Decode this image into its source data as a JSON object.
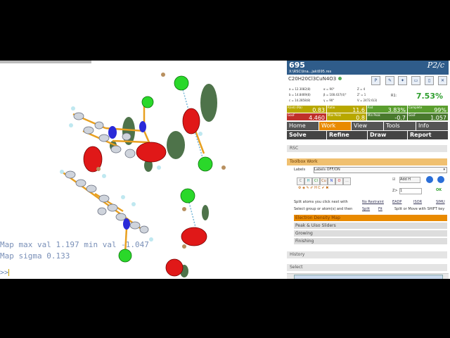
{
  "console": {
    "line1": "Map max val 1.197 min val -1.047",
    "line2": "Map sigma 0.133",
    "prompt": ">>"
  },
  "header": {
    "id": "695",
    "path": "X:\\RSC\\lina...jak\\695.res",
    "spacegroup": "P2/c",
    "formula": "C20H20Cl3CuN4O3"
  },
  "cell": {
    "a": "a = 12.3082(8)",
    "b": "b = 14.8469(8)",
    "c": "c = 14.2858(8)",
    "alpha": "α = 90°",
    "beta": "β = 108.437(4)°",
    "gamma": "γ = 90°",
    "z": "Z = 4",
    "zp": "Z' = 1",
    "v": "V = 2472.6(3)"
  },
  "r1": {
    "label": "R1:",
    "value": "7.53%"
  },
  "stats": [
    {
      "title": "R(int) (Rb)",
      "value": "0.83",
      "color": "#b8a800"
    },
    {
      "title": "Ratio",
      "value": "11.6",
      "color": "#b8a800"
    },
    {
      "title": "Rsd",
      "value": "3.83%",
      "color": "#5a9e2e"
    },
    {
      "title": "Complete",
      "value": "99%",
      "color": "#5a9e2e"
    },
    {
      "title": "GooF",
      "value": "4.460",
      "color": "#c0302a"
    },
    {
      "title": "Max Peak",
      "value": "0.8",
      "color": "#b8a800"
    },
    {
      "title": "Min Peak",
      "value": "-0.7",
      "color": "#4a7a2e"
    },
    {
      "title": "GooF",
      "value": "1.057",
      "color": "#4a7a2e"
    }
  ],
  "menu": {
    "home": "Home",
    "work": "Work",
    "view": "View",
    "tools": "Tools",
    "info": "Info",
    "solve": "Solve",
    "refine": "Refine",
    "draw": "Draw",
    "report": "Report"
  },
  "sections": {
    "rsc": "RSC",
    "toolbox": "Toolbox Work",
    "history": "History",
    "select": "Select"
  },
  "toolbox": {
    "labels_label": "Labels",
    "labels_value": "Labels OFF/ON",
    "add_h": "Add H",
    "z_label": "Z>",
    "z_value": "1",
    "ok": "OK",
    "split_text": "Split atoms you click next with",
    "no_restraint": "No Restraint",
    "eadp": "EADP",
    "isor": "ISOR",
    "simu": "SIMU",
    "select_text": "Select group or atom(s) and then",
    "split": "Split",
    "fit": "Fit",
    "split_move": "Split or Move with SHIFT key",
    "atoms": [
      "C",
      "H",
      "Cl",
      "Cu",
      "N",
      "O",
      "..."
    ]
  },
  "bars": {
    "edm": "Electron Density Map",
    "peak": "Peak & Uiso Sliders",
    "growing": "Growing",
    "finishing": "Finishing"
  },
  "icons": [
    "info-icon",
    "pencil-icon",
    "wand-icon",
    "folder-icon",
    "page-icon",
    "close-icon"
  ]
}
